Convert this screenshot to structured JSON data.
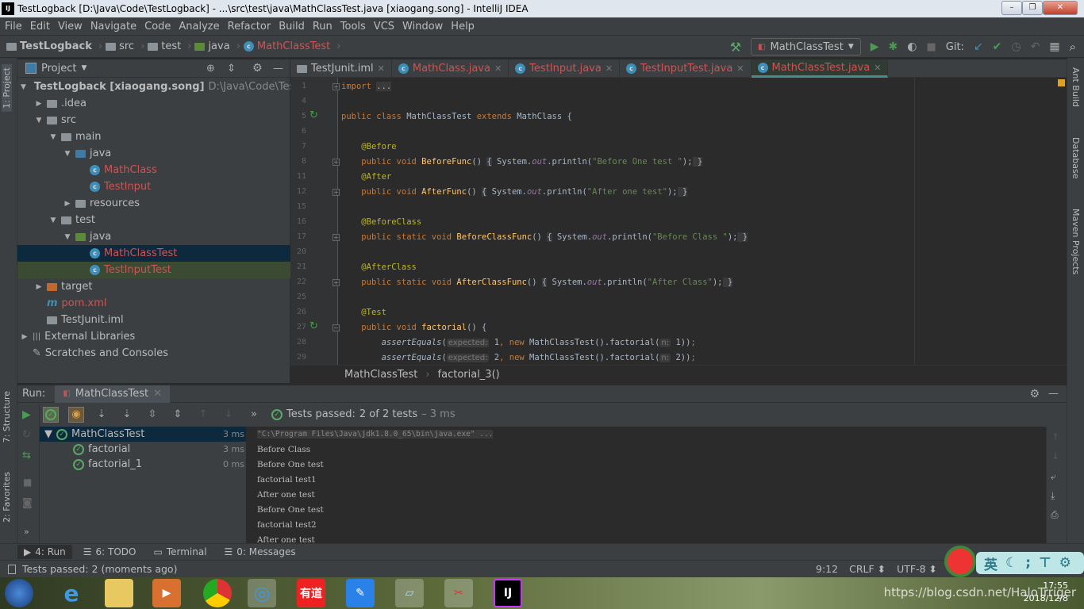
{
  "window": {
    "title": "TestLogback [D:\\Java\\Code\\TestLogback] - ...\\src\\test\\java\\MathClassTest.java [xiaogang.song] - IntelliJ IDEA",
    "logo": "IJ"
  },
  "menu": [
    "File",
    "Edit",
    "View",
    "Navigate",
    "Code",
    "Analyze",
    "Refactor",
    "Build",
    "Run",
    "Tools",
    "VCS",
    "Window",
    "Help"
  ],
  "breadcrumb": [
    "TestLogback",
    "src",
    "test",
    "java",
    "MathClassTest"
  ],
  "toolbar": {
    "run_config": "MathClassTest",
    "git_label": "Git:"
  },
  "left_stripe": {
    "project": "1: Project",
    "structure": "7: Structure",
    "favorites": "2: Favorites"
  },
  "right_stripe": {
    "ant": "Ant Build",
    "database": "Database",
    "maven": "Maven Projects"
  },
  "project": {
    "title": "Project",
    "tree": [
      {
        "label": "TestLogback [xiaogang.song]",
        "extra": "D:\\Java\\Code\\TestLo",
        "indent": 0,
        "arrow": "▼",
        "icon": "folder",
        "color": "#bbbbbb",
        "bold": true
      },
      {
        "label": ".idea",
        "indent": 1,
        "arrow": "▶",
        "icon": "folder",
        "color": "#bbbbbb"
      },
      {
        "label": "src",
        "indent": 1,
        "arrow": "▼",
        "icon": "folder",
        "color": "#bbbbbb"
      },
      {
        "label": "main",
        "indent": 2,
        "arrow": "▼",
        "icon": "folder",
        "color": "#bbbbbb"
      },
      {
        "label": "java",
        "indent": 3,
        "arrow": "▼",
        "icon": "folder-blue",
        "color": "#bbbbbb"
      },
      {
        "label": "MathClass",
        "indent": 4,
        "arrow": "",
        "icon": "class",
        "color": "#d25252"
      },
      {
        "label": "TestInput",
        "indent": 4,
        "arrow": "",
        "icon": "class",
        "color": "#d25252"
      },
      {
        "label": "resources",
        "indent": 3,
        "arrow": "▶",
        "icon": "folder",
        "color": "#bbbbbb"
      },
      {
        "label": "test",
        "indent": 2,
        "arrow": "▼",
        "icon": "folder",
        "color": "#bbbbbb"
      },
      {
        "label": "java",
        "indent": 3,
        "arrow": "▼",
        "icon": "folder-green",
        "color": "#bbbbbb"
      },
      {
        "label": "MathClassTest",
        "indent": 4,
        "arrow": "",
        "icon": "class",
        "color": "#d25252",
        "selected": true
      },
      {
        "label": "TestInputTest",
        "indent": 4,
        "arrow": "",
        "icon": "class",
        "color": "#d25252",
        "highlight": true
      },
      {
        "label": "target",
        "indent": 1,
        "arrow": "▶",
        "icon": "folder-orange",
        "color": "#bbbbbb"
      },
      {
        "label": "pom.xml",
        "indent": 1,
        "arrow": "",
        "icon": "maven",
        "color": "#d25252"
      },
      {
        "label": "TestJunit.iml",
        "indent": 1,
        "arrow": "",
        "icon": "file",
        "color": "#bbbbbb"
      },
      {
        "label": "External Libraries",
        "indent": 0,
        "arrow": "▶",
        "icon": "library",
        "color": "#bbbbbb"
      },
      {
        "label": "Scratches and Consoles",
        "indent": 0,
        "arrow": "",
        "icon": "scratch",
        "color": "#bbbbbb"
      }
    ]
  },
  "editor_tabs": [
    {
      "label": "TestJunit.iml",
      "color": "#bbbbbb",
      "icon": "file"
    },
    {
      "label": "MathClass.java",
      "color": "#d25252",
      "icon": "class"
    },
    {
      "label": "TestInput.java",
      "color": "#d25252",
      "icon": "class"
    },
    {
      "label": "TestInputTest.java",
      "color": "#d25252",
      "icon": "class"
    },
    {
      "label": "MathClassTest.java",
      "color": "#d25252",
      "icon": "class",
      "active": true
    }
  ],
  "code": [
    {
      "n": "1",
      "fold": "+",
      "t": [
        [
          "kw",
          "import "
        ],
        [
          "fold",
          "..."
        ]
      ]
    },
    {
      "n": "4",
      "t": []
    },
    {
      "n": "5",
      "run": true,
      "t": [
        [
          "kw",
          "public class "
        ],
        [
          "",
          "MathClassTest "
        ],
        [
          "kw",
          "extends "
        ],
        [
          "",
          "MathClass {"
        ]
      ]
    },
    {
      "n": "6",
      "t": []
    },
    {
      "n": "7",
      "t": [
        [
          "",
          "    "
        ],
        [
          "an",
          "@Before"
        ]
      ]
    },
    {
      "n": "8",
      "fold": "+",
      "t": [
        [
          "",
          "    "
        ],
        [
          "kw",
          "public void "
        ],
        [
          "fn",
          "BeforeFunc"
        ],
        [
          "",
          "() "
        ],
        [
          "fold",
          "{"
        ],
        [
          "",
          " System."
        ],
        [
          "fd",
          "out"
        ],
        [
          "",
          ".println("
        ],
        [
          "st",
          "\"Before One test \""
        ],
        [
          "",
          ");"
        ],
        [
          "fold",
          " }"
        ]
      ]
    },
    {
      "n": "11",
      "t": [
        [
          "",
          "    "
        ],
        [
          "an",
          "@After"
        ]
      ]
    },
    {
      "n": "12",
      "fold": "+",
      "t": [
        [
          "",
          "    "
        ],
        [
          "kw",
          "public void "
        ],
        [
          "fn",
          "AfterFunc"
        ],
        [
          "",
          "() "
        ],
        [
          "fold",
          "{"
        ],
        [
          "",
          " System."
        ],
        [
          "fd",
          "out"
        ],
        [
          "",
          ".println("
        ],
        [
          "st",
          "\"After one test\""
        ],
        [
          "",
          ");"
        ],
        [
          "fold",
          " }"
        ]
      ]
    },
    {
      "n": "15",
      "t": []
    },
    {
      "n": "16",
      "t": [
        [
          "",
          "    "
        ],
        [
          "an",
          "@BeforeClass"
        ]
      ]
    },
    {
      "n": "17",
      "fold": "+",
      "t": [
        [
          "",
          "    "
        ],
        [
          "kw",
          "public static void "
        ],
        [
          "fn",
          "BeforeClassFunc"
        ],
        [
          "",
          "() "
        ],
        [
          "fold",
          "{"
        ],
        [
          "",
          " System."
        ],
        [
          "fd",
          "out"
        ],
        [
          "",
          ".println("
        ],
        [
          "st",
          "\"Before Class \""
        ],
        [
          "",
          ");"
        ],
        [
          "fold",
          " }"
        ]
      ]
    },
    {
      "n": "20",
      "t": []
    },
    {
      "n": "21",
      "t": [
        [
          "",
          "    "
        ],
        [
          "an",
          "@AfterClass"
        ]
      ]
    },
    {
      "n": "22",
      "fold": "+",
      "t": [
        [
          "",
          "    "
        ],
        [
          "kw",
          "public static void "
        ],
        [
          "fn",
          "AfterClassFunc"
        ],
        [
          "",
          "() "
        ],
        [
          "fold",
          "{"
        ],
        [
          "",
          " System."
        ],
        [
          "fd",
          "out"
        ],
        [
          "",
          ".println("
        ],
        [
          "st",
          "\"After Class\""
        ],
        [
          "",
          ");"
        ],
        [
          "fold",
          " }"
        ]
      ]
    },
    {
      "n": "25",
      "t": []
    },
    {
      "n": "26",
      "t": [
        [
          "",
          "    "
        ],
        [
          "an",
          "@Test"
        ]
      ]
    },
    {
      "n": "27",
      "fold": "-",
      "run": true,
      "t": [
        [
          "",
          "    "
        ],
        [
          "kw",
          "public void "
        ],
        [
          "fn",
          "factorial"
        ],
        [
          "",
          "() {"
        ]
      ]
    },
    {
      "n": "28",
      "t": [
        [
          "",
          "        "
        ],
        [
          "it",
          "assertEquals"
        ],
        [
          "",
          "("
        ],
        [
          "hint",
          "expected:"
        ],
        [
          "",
          " 1"
        ],
        [
          "kw",
          ", new "
        ],
        [
          "",
          "MathClassTest().factorial("
        ],
        [
          "hint",
          "n:"
        ],
        [
          "",
          " 1))"
        ],
        [
          "kw",
          ";"
        ]
      ]
    },
    {
      "n": "29",
      "t": [
        [
          "",
          "        "
        ],
        [
          "it",
          "assertEquals"
        ],
        [
          "",
          "("
        ],
        [
          "hint",
          "expected:"
        ],
        [
          "",
          " 2"
        ],
        [
          "kw",
          ", new "
        ],
        [
          "",
          "MathClassTest().factorial("
        ],
        [
          "hint",
          "n:"
        ],
        [
          "",
          " 2))"
        ],
        [
          "kw",
          ";"
        ]
      ]
    }
  ],
  "editor_breadcrumb": [
    "MathClassTest",
    "factorial_3()"
  ],
  "run": {
    "label": "Run:",
    "tab": "MathClassTest",
    "status": "Tests passed:",
    "status_count": "2 of 2 tests",
    "status_time": "– 3 ms",
    "tests": [
      {
        "name": "MathClassTest",
        "time": "3 ms",
        "indent": 0,
        "root": true
      },
      {
        "name": "factorial",
        "time": "3 ms",
        "indent": 1
      },
      {
        "name": "factorial_1",
        "time": "0 ms",
        "indent": 1
      }
    ],
    "console": [
      "\"C:\\Program Files\\Java\\jdk1.8.0_65\\bin\\java.exe\" ...",
      "Before Class",
      "Before One test",
      "factorial test1",
      "After one test",
      "Before One test",
      "factorial test2",
      "After one test"
    ]
  },
  "bottom_tabs": [
    {
      "label": "4: Run",
      "active": true
    },
    {
      "label": "6: TODO"
    },
    {
      "label": "Terminal"
    },
    {
      "label": "0: Messages"
    }
  ],
  "status": {
    "message": "Tests passed: 2 (moments ago)",
    "position": "9:12",
    "line_sep": "CRLF ⬍",
    "encoding": "UTF-8 ⬍"
  },
  "ime": {
    "label": "英"
  },
  "taskbar": {
    "time": "17:55",
    "date": "2018/12/8",
    "watermark": "https://blog.csdn.net/HaloTrriger"
  },
  "colors": {
    "accent": "#4a8a8c",
    "pass": "#59a869",
    "error_file": "#d25252",
    "bg": "#2b2b2b",
    "panel": "#3c3f41"
  }
}
